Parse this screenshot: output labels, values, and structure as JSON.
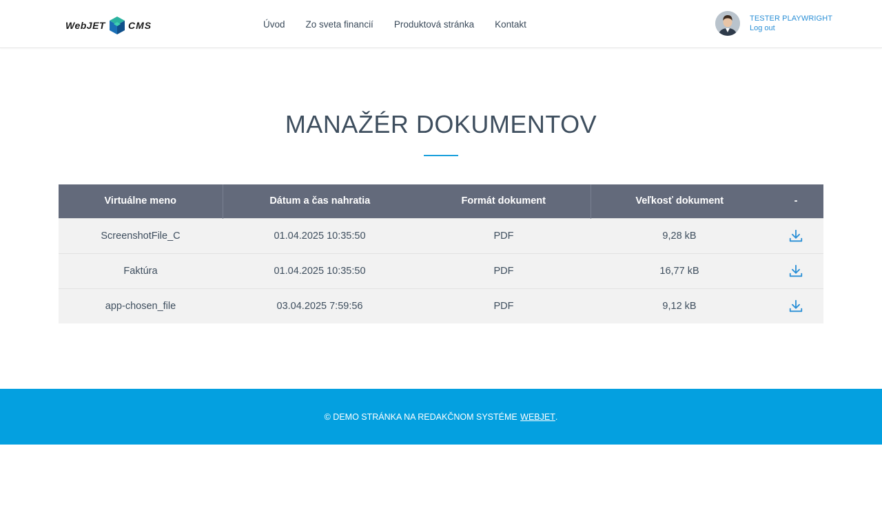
{
  "header": {
    "logo": {
      "left": "WebJET",
      "right": "CMS"
    },
    "nav": [
      "Úvod",
      "Zo sveta financií",
      "Produktová stránka",
      "Kontakt"
    ],
    "user": {
      "name": "TESTER PLAYWRIGHT",
      "logout": "Log out"
    }
  },
  "main": {
    "title": "MANAŽÉR DOKUMENTOV",
    "table": {
      "headers": [
        "Virtuálne meno",
        "Dátum a čas nahratia",
        "Formát dokument",
        "Veľkosť dokument",
        "-"
      ],
      "rows": [
        {
          "name": "ScreenshotFile_C",
          "date": "01.04.2025 10:35:50",
          "format": "PDF",
          "size": "9,28 kB",
          "action_icon": "download-icon"
        },
        {
          "name": "Faktúra",
          "date": "01.04.2025 10:35:50",
          "format": "PDF",
          "size": "16,77 kB",
          "action_icon": "download-icon"
        },
        {
          "name": "app-chosen_file",
          "date": "03.04.2025 7:59:56",
          "format": "PDF",
          "size": "9,12 kB",
          "action_icon": "download-icon"
        }
      ]
    }
  },
  "footer": {
    "text": "© DEMO STRÁNKA NA REDAKČNOM SYSTÉME",
    "link": "WEBJET",
    "suffix": "."
  },
  "colors": {
    "accent": "#04a0e0",
    "table_header": "#636a7b",
    "row_bg": "#f2f2f2",
    "link": "#2a8fd6"
  }
}
